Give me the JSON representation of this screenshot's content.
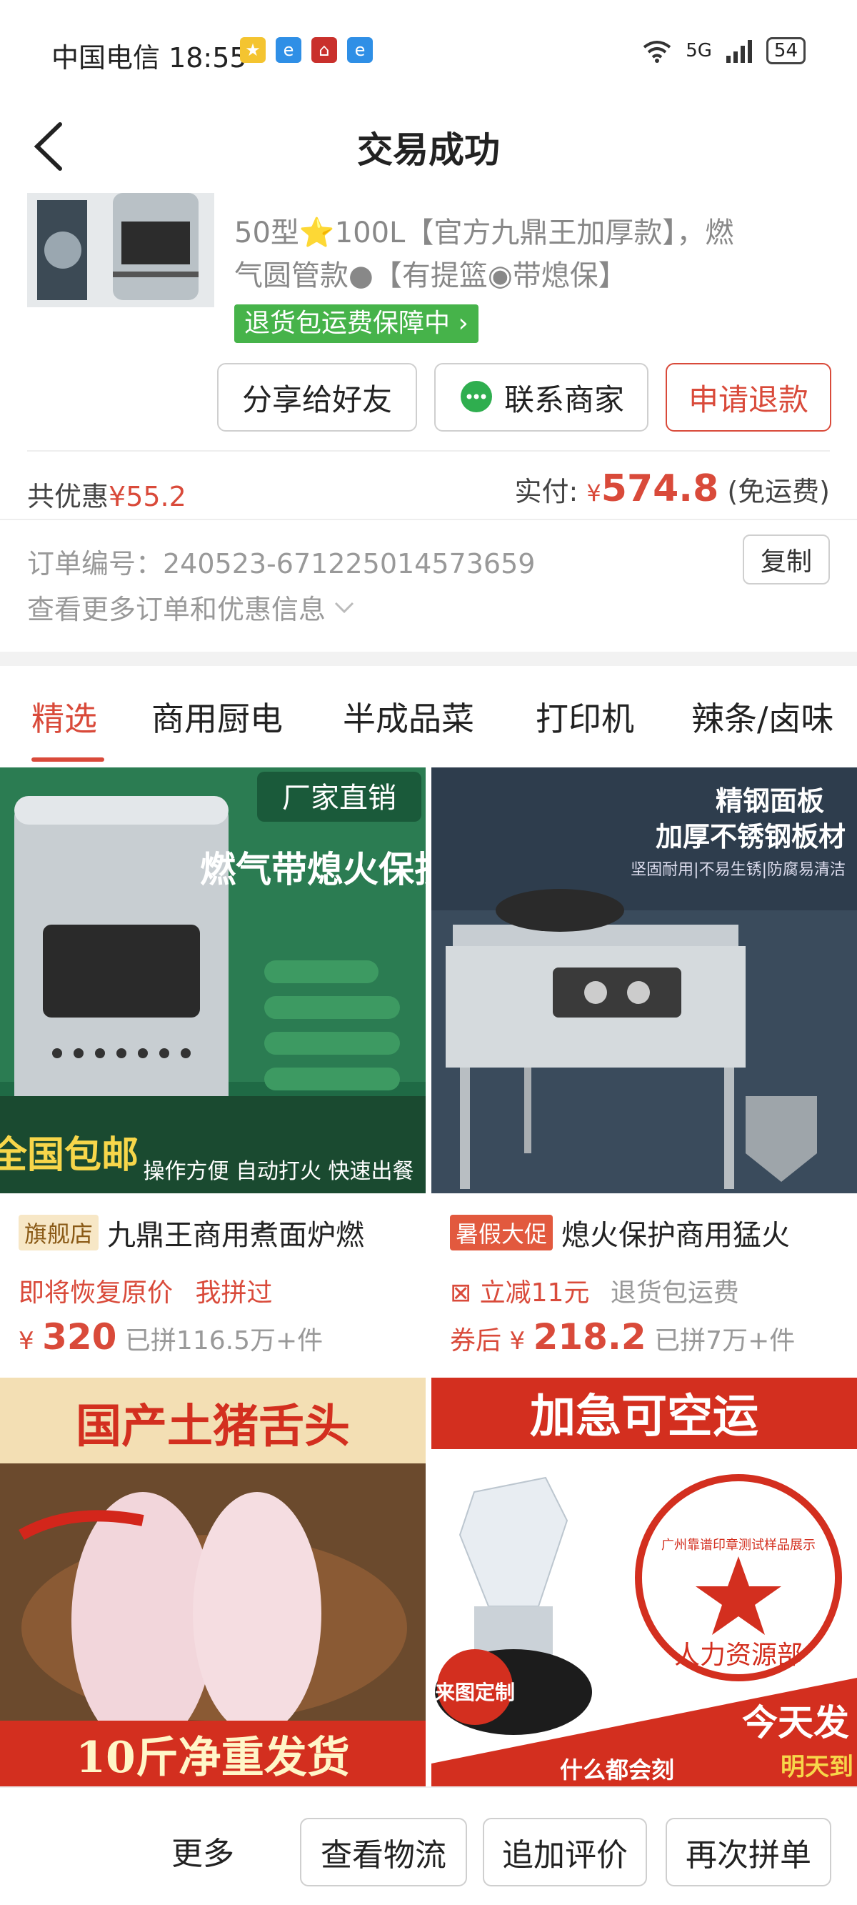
{
  "status_bar": {
    "carrier_time": "中国电信 18:55",
    "network": "5G",
    "battery": "54"
  },
  "header": {
    "title": "交易成功"
  },
  "order_item": {
    "description": "50型⭐100L【官方九鼎王加厚款】，燃气圆管款●【有提篮◉带熄保】",
    "guarantee_label": "退货包运费保障中",
    "actions": {
      "share": "分享给好友",
      "contact": "联系商家",
      "refund": "申请退款"
    }
  },
  "summary": {
    "discount_label": "共优惠",
    "discount_amount": "¥55.2",
    "paid_label": "实付:",
    "paid_currency": "¥",
    "paid_amount": "574.8",
    "shipping_note": "(免运费)"
  },
  "order_info": {
    "order_number": "订单编号：240523-671225014573659",
    "copy_label": "复制",
    "more_link": "查看更多订单和优惠信息"
  },
  "tabs": [
    {
      "label": "精选"
    },
    {
      "label": "商用厨电"
    },
    {
      "label": "半成品菜"
    },
    {
      "label": "打印机"
    },
    {
      "label": "辣条/卤味"
    }
  ],
  "products": [
    {
      "image_text_1": "厂家直销",
      "image_text_2": "燃气带熄火保护",
      "image_text_3": "全国包邮",
      "image_text_4": "操作方便 自动打火 快速出餐",
      "tag": "旗舰店",
      "title": "九鼎王商用煮面炉燃",
      "sub_1": "即将恢复原价",
      "sub_2": "我拼过",
      "price_currency": "¥",
      "price": "320",
      "sold": "已拼116.5万+件"
    },
    {
      "image_text_1": "精钢面板",
      "image_text_2": "加厚不锈钢板材",
      "image_text_3": "坚固耐用|不易生锈|防腐易清洁",
      "tag": "暑假大促",
      "title": "熄火保护商用猛火",
      "sub_1": "立减11元",
      "sub_2": "退货包运费",
      "price_prefix": "券后",
      "price_currency": "¥",
      "price": "218.2",
      "sold": "已拼7万+件"
    },
    {
      "image_text_1": "国产土猪舌头",
      "image_text_2": "10斤净重发货"
    },
    {
      "image_text_1": "加急可空运",
      "image_text_2": "广州靠谱印章测试样品展示",
      "image_text_3": "人力资源部",
      "image_text_4": "什么都会刻",
      "image_text_5": "今天发",
      "image_text_6": "明天到",
      "image_text_7": "来图定制"
    }
  ],
  "bottom_bar": {
    "more": "更多",
    "logistics": "查看物流",
    "add_review": "追加评价",
    "reorder": "再次拼单"
  },
  "colors": {
    "accent": "#d94a3a",
    "guarantee": "#46b34a",
    "wechat_green": "#2fae4f"
  }
}
